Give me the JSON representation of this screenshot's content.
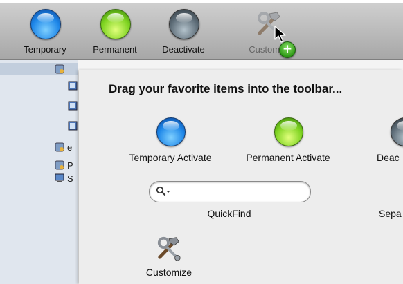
{
  "toolbar": {
    "items": [
      {
        "label": "Temporary",
        "icon": "blue-orb-icon"
      },
      {
        "label": "Permanent",
        "icon": "green-orb-icon"
      },
      {
        "label": "Deactivate",
        "icon": "gray-orb-icon"
      }
    ],
    "customize_label": "Customize",
    "drag_badge": "+"
  },
  "sheet": {
    "title": "Drag your favorite items into the toolbar...",
    "palette": [
      {
        "label": "Temporary Activate",
        "icon": "blue-orb-icon"
      },
      {
        "label": "Permanent Activate",
        "icon": "green-orb-icon"
      },
      {
        "label": "Deac",
        "icon": "gray-orb-icon"
      }
    ],
    "quickfind_label": "QuickFind",
    "separator_label": "Sepa",
    "customize_label": "Customize"
  },
  "sidebar": {
    "fragments": [
      "e",
      "P",
      "S"
    ]
  },
  "colors": {
    "accent_blue": "#1d86e8",
    "accent_green": "#7ed321",
    "deactivate_gray": "#5e6d78",
    "badge_green": "#2f9a17"
  }
}
